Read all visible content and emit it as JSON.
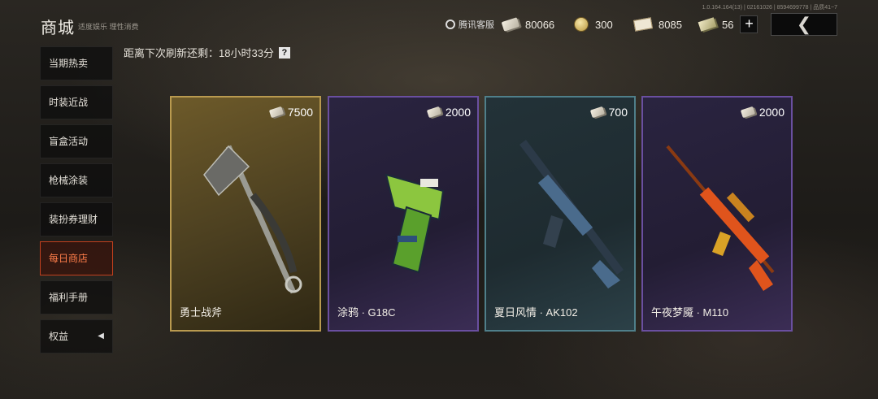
{
  "header": {
    "title": "商城",
    "subtitle": "适度娱乐 理性消费",
    "version": "1.0.164.164(13) | 02161026 | 8594699778 | 品质41~7",
    "support_label": "腾讯客服"
  },
  "currencies": [
    {
      "icon": "ticket-icon",
      "value": "80066"
    },
    {
      "icon": "coin-icon",
      "value": "300"
    },
    {
      "icon": "voucher-icon",
      "value": "8085"
    },
    {
      "icon": "cash-icon",
      "value": "56"
    }
  ],
  "add_label": "+",
  "back_label": "❮",
  "sidebar": {
    "items": [
      {
        "label": "当期热卖"
      },
      {
        "label": "时装近战"
      },
      {
        "label": "盲盒活动"
      },
      {
        "label": "枪械涂装"
      },
      {
        "label": "装扮券理财"
      },
      {
        "label": "每日商店"
      },
      {
        "label": "福利手册"
      },
      {
        "label": "权益",
        "chevron": "◀"
      }
    ],
    "active_index": 5
  },
  "refresh": {
    "text": "距离下次刷新还剩：18小时33分",
    "help": "?"
  },
  "products": [
    {
      "name": "勇士战斧",
      "price": "7500",
      "rarity_color": "#b99a4f"
    },
    {
      "name": "涂鸦 · G18C",
      "price": "2000",
      "rarity_color": "#6a4fa0"
    },
    {
      "name": "夏日风情 · AK102",
      "price": "700",
      "rarity_color": "#4f7f8a"
    },
    {
      "name": "午夜梦魇 · M110",
      "price": "2000",
      "rarity_color": "#6a4fa0"
    }
  ]
}
